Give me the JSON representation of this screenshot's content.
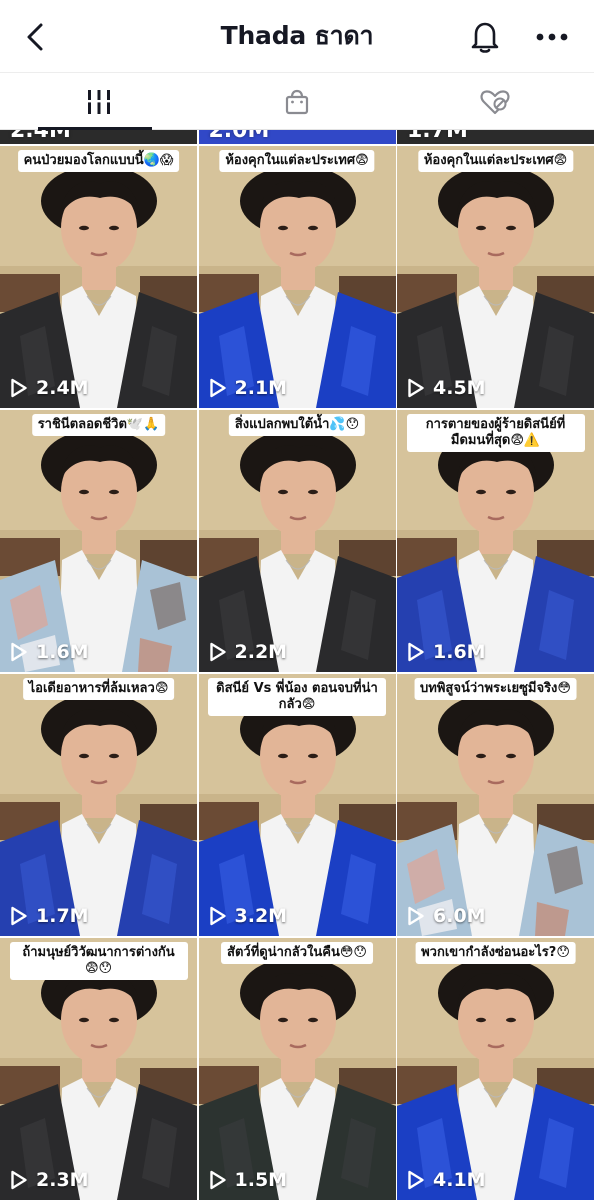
{
  "header": {
    "title": "Thada ธาดา",
    "back_icon": "chevron-left-icon",
    "bell_icon": "bell-icon",
    "more_icon": "more-horizontal-icon"
  },
  "tabs": [
    {
      "name": "videos",
      "icon": "grid-bars-icon",
      "active": true
    },
    {
      "name": "shop",
      "icon": "shopping-bag-icon",
      "active": false
    },
    {
      "name": "liked",
      "icon": "heart-hidden-icon",
      "active": false
    }
  ],
  "partial_row": [
    "2.4M",
    "2.0M",
    "1.7M"
  ],
  "videos": [
    {
      "caption": "คนป่วยมองโลกแบบนี้🌏😱",
      "views": "2.4M",
      "outfit": "black"
    },
    {
      "caption": "ห้องคุกในแต่ละประเทศ😨",
      "views": "2.1M",
      "outfit": "blue"
    },
    {
      "caption": "ห้องคุกในแต่ละประเทศ😨",
      "views": "4.5M",
      "outfit": "black"
    },
    {
      "caption": "ราชินีตลอดชีวิต🕊️🙏",
      "views": "1.6M",
      "outfit": "pattern"
    },
    {
      "caption": "สิ่งแปลกพบใต้น้ำ💦😯",
      "views": "2.2M",
      "outfit": "black"
    },
    {
      "caption": "การตายของผู้ร้ายดิสนีย์ที่ มืดมนที่สุด😨⚠️",
      "views": "1.6M",
      "outfit": "bluejacket"
    },
    {
      "caption": "ไอเดียอาหารที่ล้มเหลว😨",
      "views": "1.7M",
      "outfit": "bluejacket"
    },
    {
      "caption": "ดิสนีย์ Vs พี่น้อง ตอนจบที่น่ากลัว😨",
      "views": "3.2M",
      "outfit": "blue"
    },
    {
      "caption": "บทพิสูจน์ว่าพระเยซูมีจริง😳",
      "views": "6.0M",
      "outfit": "pattern"
    },
    {
      "caption": "ถ้ามนุษย์วิวัฒนาการต่างกัน 😨😯",
      "views": "2.3M",
      "outfit": "black"
    },
    {
      "caption": "สัตว์ที่ดูน่ากลัวในคืน😳😯",
      "views": "1.5M",
      "outfit": "darkgreen"
    },
    {
      "caption": "พวกเขากำลังซ่อนอะไร?😯",
      "views": "4.1M",
      "outfit": "blue"
    }
  ],
  "colors": {
    "text": "#161823",
    "divider": "#e3e3e3",
    "wall": "#c9b48a",
    "skin": "#e2b597",
    "hair": "#1b1613",
    "undershirt": "#f3f3f3",
    "outfit_black": "#2a2a2c",
    "outfit_blue": "#1b3fc4",
    "outfit_bluejacket": "#2540b0",
    "outfit_darkgreen": "#2c3330",
    "outfit_pattern": "#a9c2d6"
  }
}
